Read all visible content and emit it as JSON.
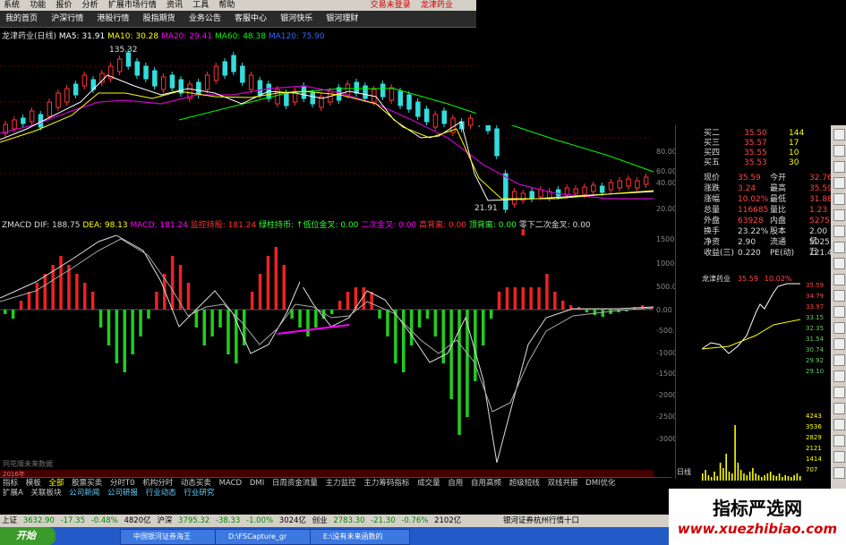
{
  "menu": {
    "items": [
      "系统",
      "功能",
      "报价",
      "分析",
      "扩展市场行情",
      "资讯",
      "工具",
      "帮助"
    ],
    "right_items": [
      "交易未登录",
      "龙津药业"
    ]
  },
  "nav": {
    "items": [
      "我的首页",
      "沪深行情",
      "港股行情",
      "股指期货",
      "业务公告",
      "客服中心",
      "银河快乐",
      "银河理财"
    ]
  },
  "ma_line": {
    "stock": "龙津药业(日线)",
    "ma5": "MA5: 31.91",
    "ma10": "MA10: 30.28",
    "ma20": "MA20: 29.41",
    "ma60": "MA60: 48.38",
    "ma120": "MA120: 75.90",
    "colors": {
      "ma5": "#ffffff",
      "ma10": "#ffff00",
      "ma20": "#ff00ff",
      "ma60": "#00ff00",
      "ma120": "#3366ff"
    }
  },
  "price_chart": {
    "high_label": "135.32",
    "low_label": "21.91",
    "axis_right": [
      "80.00",
      "60.00",
      "40.00",
      "20.00"
    ],
    "colors": {
      "up": "#ff3333",
      "down": "#33dddd"
    }
  },
  "macd_line": {
    "name": "ZMACD",
    "dif": "DIF: 188.75",
    "dea": "DEA: 98.13",
    "macd": "MACD: 181.24",
    "s1": "监控持股: 181.24",
    "s2": "绿柱持币: ↑低位金叉: 0.00",
    "s3": "二次金叉: 0.00",
    "s4": "高背离: 0.00",
    "s5": "顶背离: 0.00",
    "s6": "零下二次金叉: 0.00"
  },
  "macd_axis": [
    "1500",
    "1000",
    "500.00",
    "0.00",
    "-500.00",
    "-1000",
    "-1500",
    "-2000",
    "-2500",
    "-3000"
  ],
  "tabs1": [
    "指标",
    "模板",
    "全部",
    "股票买卖",
    "分时T0",
    "机构分时",
    "动态买卖",
    "MACD",
    "DMI",
    "日周资金流量",
    "主力监控",
    "主力筹码指标",
    "成交量",
    "自用",
    "自用高频",
    "超级短线",
    "双线共振",
    "DMI优化"
  ],
  "tabs2": [
    "扩展A",
    "关联板块",
    "公司新闻",
    "公司研报",
    "行业动态",
    "行业研究"
  ],
  "date_axis": {
    "year": "2016年",
    "bottom_label": "同花顺未来数据"
  },
  "status": {
    "sh": "上证",
    "sh_val": "3632.90",
    "sh_chg": "-17.35",
    "sh_pct": "-0.48%",
    "sh_amt": "4820亿",
    "sz": "沪深",
    "sz_val": "3795.32",
    "sz_chg": "-38.33",
    "sz_pct": "-1.00%",
    "sz_amt": "3024亿",
    "cy": "创业",
    "cy_val": "2783.30",
    "cy_chg": "-21.30",
    "cy_pct": "-0.76%",
    "cy_amt": "2102亿",
    "server": "银河证券杭州行情十口"
  },
  "taskbar": {
    "start": "开始",
    "task1": "中国银河证券海王",
    "task2": "D:\\FSCapture_gr",
    "task3": "E:\\没有未来函数的"
  },
  "quote": {
    "buy": [
      {
        "label": "买二",
        "price": "35.50",
        "vol": "144"
      },
      {
        "label": "买三",
        "price": "35.57",
        "vol": "17"
      },
      {
        "label": "买四",
        "price": "35.55",
        "vol": "10"
      },
      {
        "label": "买五",
        "price": "35.53",
        "vol": "30"
      }
    ],
    "rows": [
      {
        "l1": "现价",
        "v1": "35.59",
        "l2": "今开",
        "v2": "32.76"
      },
      {
        "l1": "涨跌",
        "v1": "3.24",
        "l2": "最高",
        "v2": "35.59"
      },
      {
        "l1": "涨幅",
        "v1": "10.02%",
        "l2": "最低",
        "v2": "31.88"
      },
      {
        "l1": "总量",
        "v1": "116685",
        "l2": "量比",
        "v2": "1.23"
      },
      {
        "l1": "外盘",
        "v1": "63928",
        "l2": "内盘",
        "v2": "52757"
      },
      {
        "l1": "换手",
        "v1": "23.22%",
        "l2": "股本",
        "v2": "2.00亿"
      },
      {
        "l1": "净资",
        "v1": "2.90",
        "l2": "流通",
        "v2": "5025万"
      },
      {
        "l1": "收益(三)",
        "v1": "0.220",
        "l2": "PE(动)",
        "v2": "121.4"
      }
    ],
    "mini_title": "龙津药业",
    "mini_price": "35.59",
    "mini_pct": "10.02%",
    "mini_axis": [
      "35.59",
      "34.79",
      "33.97",
      "33.15",
      "32.35",
      "31.54",
      "30.74",
      "29.92",
      "29.10"
    ],
    "mini_vol_axis": [
      "4243",
      "3536",
      "2829",
      "2121",
      "1414",
      "707"
    ],
    "mini_day_label": "日线"
  },
  "watermark": {
    "cn": "指标严选网",
    "url": "www.xuezhibiao.com"
  }
}
